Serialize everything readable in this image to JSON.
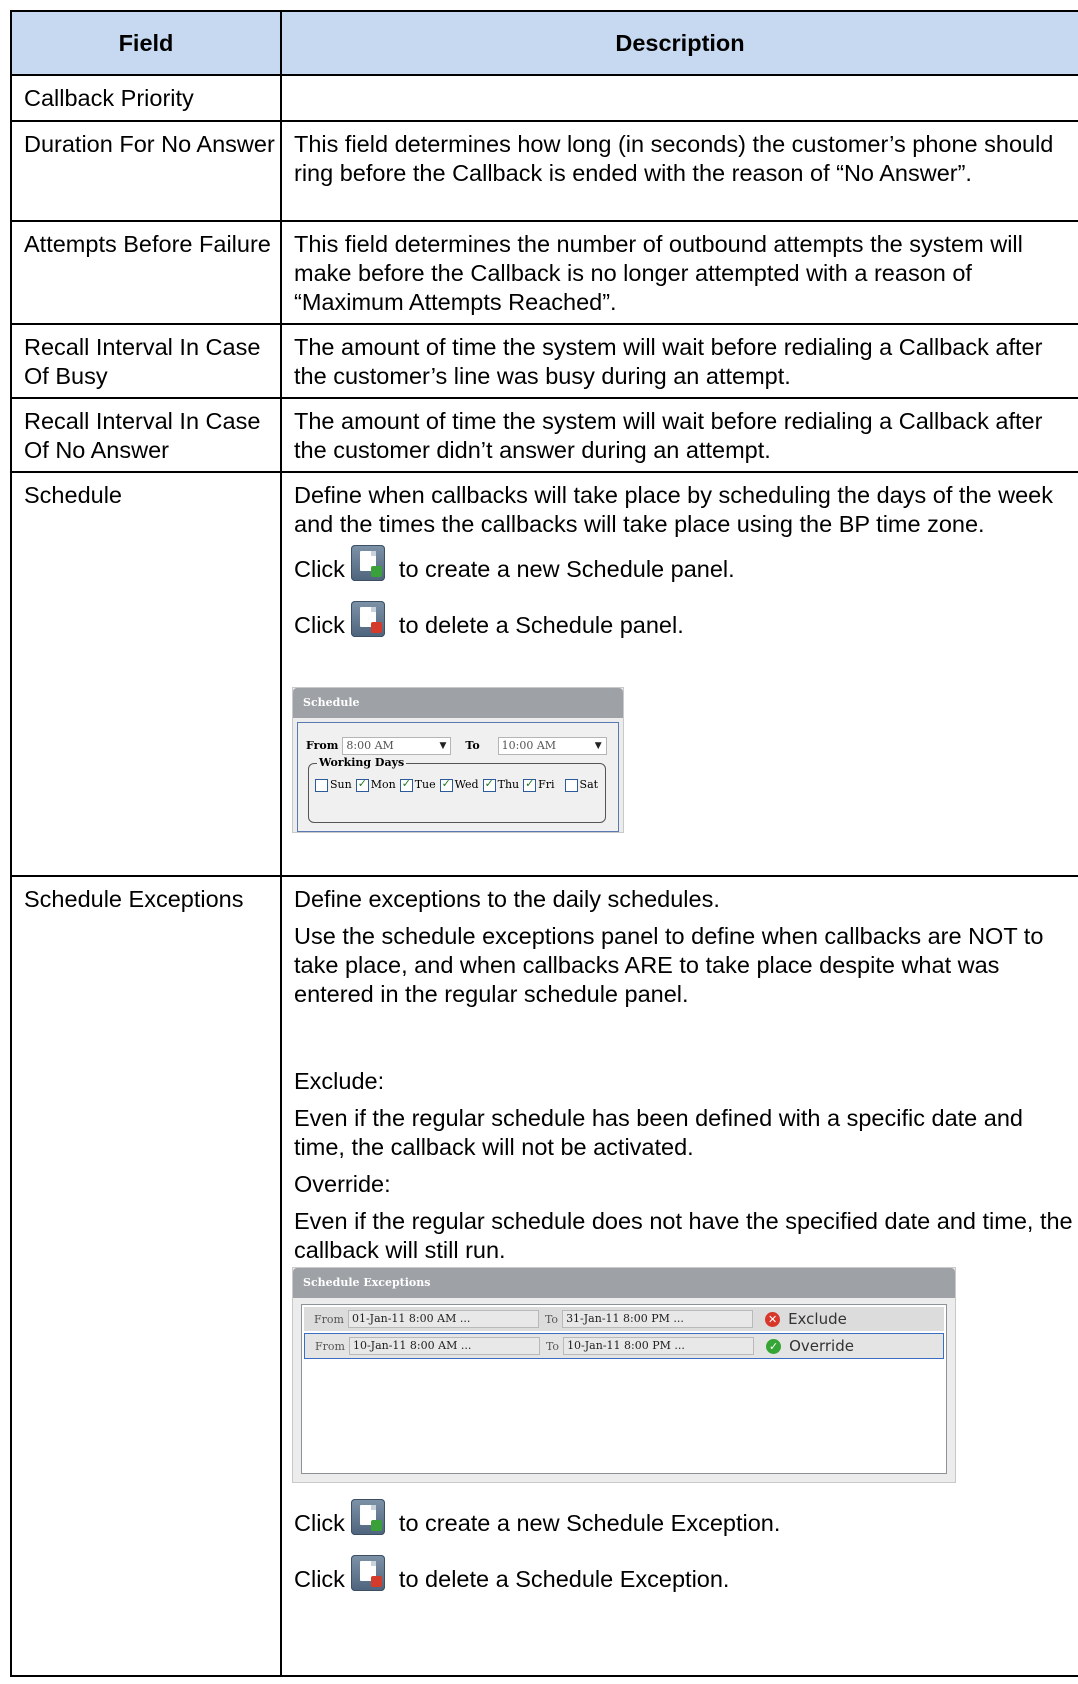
{
  "headers": {
    "field": "Field",
    "description": "Description"
  },
  "rows": [
    {
      "field": "Callback Priority",
      "description": ""
    },
    {
      "field": "Duration For No Answer",
      "description": "This field determines how long (in seconds) the customer’s phone should ring before the Callback is ended with the reason of “No Answer”."
    },
    {
      "field": "Attempts Before Failure",
      "description": "This field determines the number of outbound attempts the system will make before the Callback is no longer attempted with a reason of “Maximum Attempts Reached”."
    },
    {
      "field": "Recall Interval In Case Of Busy",
      "description": "The amount of time the system will wait before redialing a Callback after the customer’s line was busy during an attempt."
    },
    {
      "field": "Recall Interval In Case Of No Answer",
      "description": "The amount of time the system will wait before redialing a Callback after the customer didn’t answer during an attempt."
    },
    {
      "field": "Schedule",
      "description": "Define when callbacks will take place by scheduling the days of the week and the times the callbacks will take place using the BP time zone.",
      "click_word": "Click",
      "add_text": "to create a new Schedule panel.",
      "delete_text": "to delete a Schedule panel."
    },
    {
      "field": "Schedule Exceptions",
      "p1": "Define exceptions to the daily schedules.",
      "p2": "Use the schedule exceptions panel to define when callbacks are NOT to take place, and when callbacks ARE to take place despite what was entered in the regular schedule panel.",
      "exclude_heading": "Exclude:",
      "exclude_text": "Even if the regular schedule has been defined with a specific date and time, the callback will not be activated.",
      "override_heading": "Override:",
      "override_text": "Even if the regular schedule does not have the specified date and time, the callback will still run.",
      "click_word": "Click",
      "add_text": "to create a new Schedule Exception.",
      "delete_text": "to delete a Schedule Exception."
    }
  ],
  "schedule_panel": {
    "title": "Schedule",
    "from_label": "From",
    "from_value": "8:00 AM",
    "to_label": "To",
    "to_value": "10:00 AM",
    "working_days_label": "Working Days",
    "days": [
      {
        "label": "Sun",
        "checked": false
      },
      {
        "label": "Mon",
        "checked": true
      },
      {
        "label": "Tue",
        "checked": true
      },
      {
        "label": "Wed",
        "checked": true
      },
      {
        "label": "Thu",
        "checked": true
      },
      {
        "label": "Fri",
        "checked": true
      },
      {
        "label": "Sat",
        "checked": false
      }
    ]
  },
  "exceptions_panel": {
    "title": "Schedule Exceptions",
    "from_label": "From",
    "to_label": "To",
    "rows": [
      {
        "from": "01-Jan-11 8:00 AM ...",
        "to": "31-Jan-11 8:00 PM ...",
        "status": "Exclude",
        "icon": "exclude-icon"
      },
      {
        "from": "10-Jan-11 8:00 AM ...",
        "to": "10-Jan-11 8:00 PM ...",
        "status": "Override",
        "icon": "override-icon"
      }
    ]
  },
  "colors": {
    "header_bg": "#c6d9f1",
    "panel_header": "#9ea2a6"
  }
}
